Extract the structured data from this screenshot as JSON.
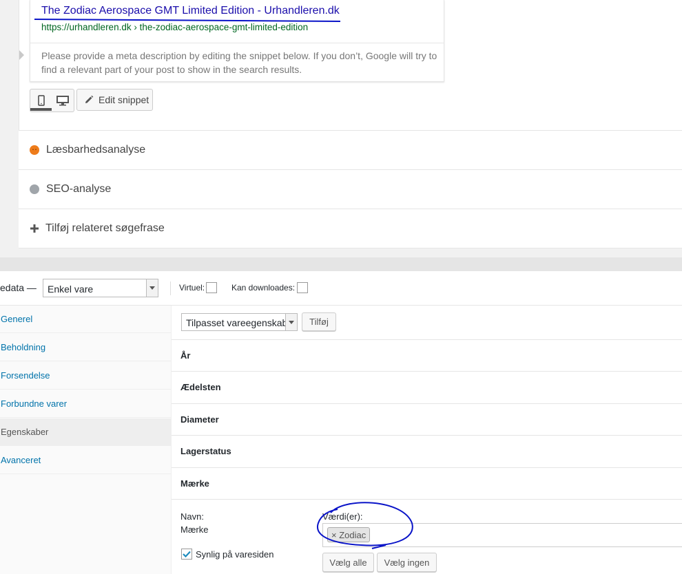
{
  "snippet": {
    "title": "The Zodiac Aerospace GMT Limited Edition - Urhandleren.dk",
    "url": "https://urhandleren.dk › the-zodiac-aerospace-gmt-limited-edition",
    "description": "Please provide a meta description by editing the snippet below. If you don’t, Google will try to find a relevant part of your post to show in the search results.",
    "edit_label": "Edit snippet"
  },
  "yoast": {
    "readability_label": "Læsbarhedsanalyse",
    "seo_label": "SEO-analyse",
    "related_label": "Tilføj relateret søgefrase",
    "readability_color": "#ee7c1b",
    "seo_color": "#a0a5aa"
  },
  "product_data": {
    "label": "edata —",
    "type_select": "Enkel vare",
    "virtual_label": "Virtuel:",
    "downloadable_label": "Kan downloades:"
  },
  "tabs": [
    {
      "label": "Generel"
    },
    {
      "label": "Beholdning"
    },
    {
      "label": "Forsendelse"
    },
    {
      "label": "Forbundne varer"
    },
    {
      "label": "Egenskaber",
      "active": true
    },
    {
      "label": "Avanceret"
    }
  ],
  "attributes": {
    "select_value": "Tilpasset vareegenskab",
    "add_button": "Tilføj",
    "rows": [
      "År",
      "Ædelsten",
      "Diameter",
      "Lagerstatus",
      "Mærke"
    ],
    "name_label": "Navn:",
    "name_value": "Mærke",
    "values_label": "Værdi(er):",
    "token": "× Zodiac",
    "visible_label": "Synlig på varesiden",
    "select_all": "Vælg alle",
    "select_none": "Vælg ingen"
  },
  "colors": {
    "link": "#0073aa",
    "google_title": "#1a0dab",
    "google_url": "#006621",
    "annotation": "#0a14c8"
  }
}
